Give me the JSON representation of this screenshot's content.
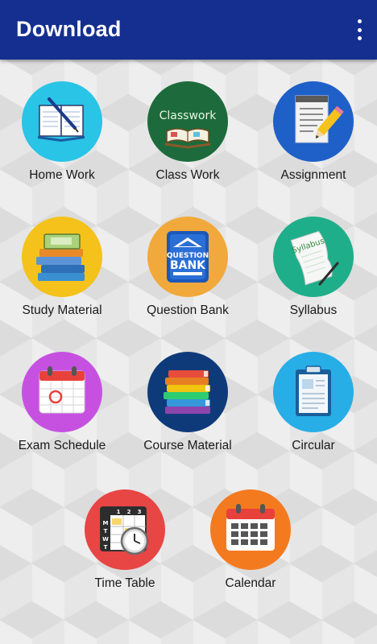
{
  "appbar": {
    "title": "Download",
    "menu_icon": "more-vert-icon",
    "background": "#142f8f"
  },
  "tiles": [
    {
      "label": "Home Work",
      "icon": "notebook-pen-icon",
      "color": "#29c4e6"
    },
    {
      "label": "Class Work",
      "icon": "classwork-board-icon",
      "color": "#1d6b3c",
      "icon_text": "Classwork"
    },
    {
      "label": "Assignment",
      "icon": "document-pencil-icon",
      "color": "#1f5fc8"
    },
    {
      "label": "Study Material",
      "icon": "book-stack-icon",
      "color": "#f4c21a"
    },
    {
      "label": "Question Bank",
      "icon": "question-bank-icon",
      "color": "#f2a93b",
      "icon_text": [
        "QUESTION",
        "BANK"
      ]
    },
    {
      "label": "Syllabus",
      "icon": "syllabus-paper-icon",
      "color": "#1fae8a",
      "icon_text": "Syllabus"
    },
    {
      "label": "Exam Schedule",
      "icon": "calendar-check-icon",
      "color": "#c651e0"
    },
    {
      "label": "Course Material",
      "icon": "colored-books-icon",
      "color": "#0f3a7a"
    },
    {
      "label": "Circular",
      "icon": "clipboard-icon",
      "color": "#28aee6"
    },
    {
      "label": "Time Table",
      "icon": "timetable-clock-icon",
      "color": "#e84545",
      "icon_text": [
        "M",
        "T",
        "W",
        "T",
        "1",
        "2",
        "3"
      ]
    },
    {
      "label": "Calendar",
      "icon": "calendar-grid-icon",
      "color": "#f47a20"
    }
  ]
}
